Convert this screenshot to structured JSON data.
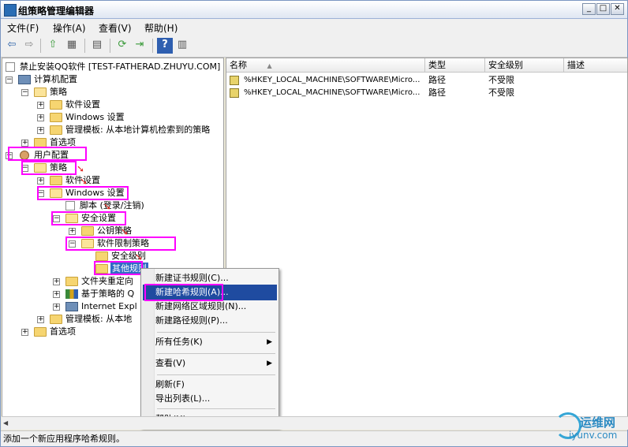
{
  "window": {
    "title": "组策略管理编辑器",
    "btn_min": "_",
    "btn_max": "□",
    "btn_close": "✕"
  },
  "menubar": [
    "文件(F)",
    "操作(A)",
    "查看(V)",
    "帮助(H)"
  ],
  "toolbar": {
    "back_glyph": "⇦",
    "forward_glyph": "⇨",
    "up_glyph": "⇧",
    "tree_glyph": "▦",
    "props_glyph": "▤",
    "refresh_glyph": "⟳",
    "export_glyph": "⇥",
    "help_glyph": "?",
    "view_glyph": "▥"
  },
  "tree": {
    "root": "禁止安装QQ软件 [TEST-FATHERAD.ZHUYU.COM] 策",
    "computer_config": "计算机配置",
    "cc_policies": "策略",
    "cc_software": "软件设置",
    "cc_windows": "Windows 设置",
    "cc_admin": "管理模板: 从本地计算机检索到的策略",
    "cc_prefs": "首选项",
    "user_config": "用户配置",
    "uc_policies": "策略",
    "uc_software": "软件设置",
    "uc_windows": "Windows 设置",
    "uc_scripts": "脚本 (登录/注销)",
    "uc_security": "安全设置",
    "uc_pubkey": "公钥策略",
    "uc_srp": "软件限制策略",
    "uc_seclevel": "安全级别",
    "uc_otherrules": "其他规则",
    "uc_folderredir": "文件夹重定向",
    "uc_qos": "基于策略的 Q",
    "uc_ie": "Internet Expl",
    "uc_admin": "管理模板: 从本地",
    "uc_prefs": "首选项"
  },
  "columns": {
    "name": "名称",
    "type": "类型",
    "level": "安全级别",
    "desc": "描述",
    "sort_glyph": "▲"
  },
  "rows": [
    {
      "name": "%HKEY_LOCAL_MACHINE\\SOFTWARE\\Micro...",
      "type": "路径",
      "level": "不受限"
    },
    {
      "name": "%HKEY_LOCAL_MACHINE\\SOFTWARE\\Micro...",
      "type": "路径",
      "level": "不受限"
    }
  ],
  "context_menu": {
    "new_cert": "新建证书规则(C)...",
    "new_hash": "新建哈希规则(A)...",
    "new_network": "新建网络区域规则(N)...",
    "new_path": "新建路径规则(P)...",
    "all_tasks": "所有任务(K)",
    "view": "查看(V)",
    "refresh": "刷新(F)",
    "export": "导出列表(L)...",
    "help": "帮助(H)",
    "submenu_glyph": "▶"
  },
  "statusbar": "添加一个新应用程序哈希规则。",
  "watermark": {
    "cn": "运维网",
    "en": "iyunv.com"
  },
  "colors": {
    "highlight": "#ff00ff",
    "selection": "#316ac5",
    "menu_active": "#1f4ba0",
    "arrow": "#e0302a"
  }
}
